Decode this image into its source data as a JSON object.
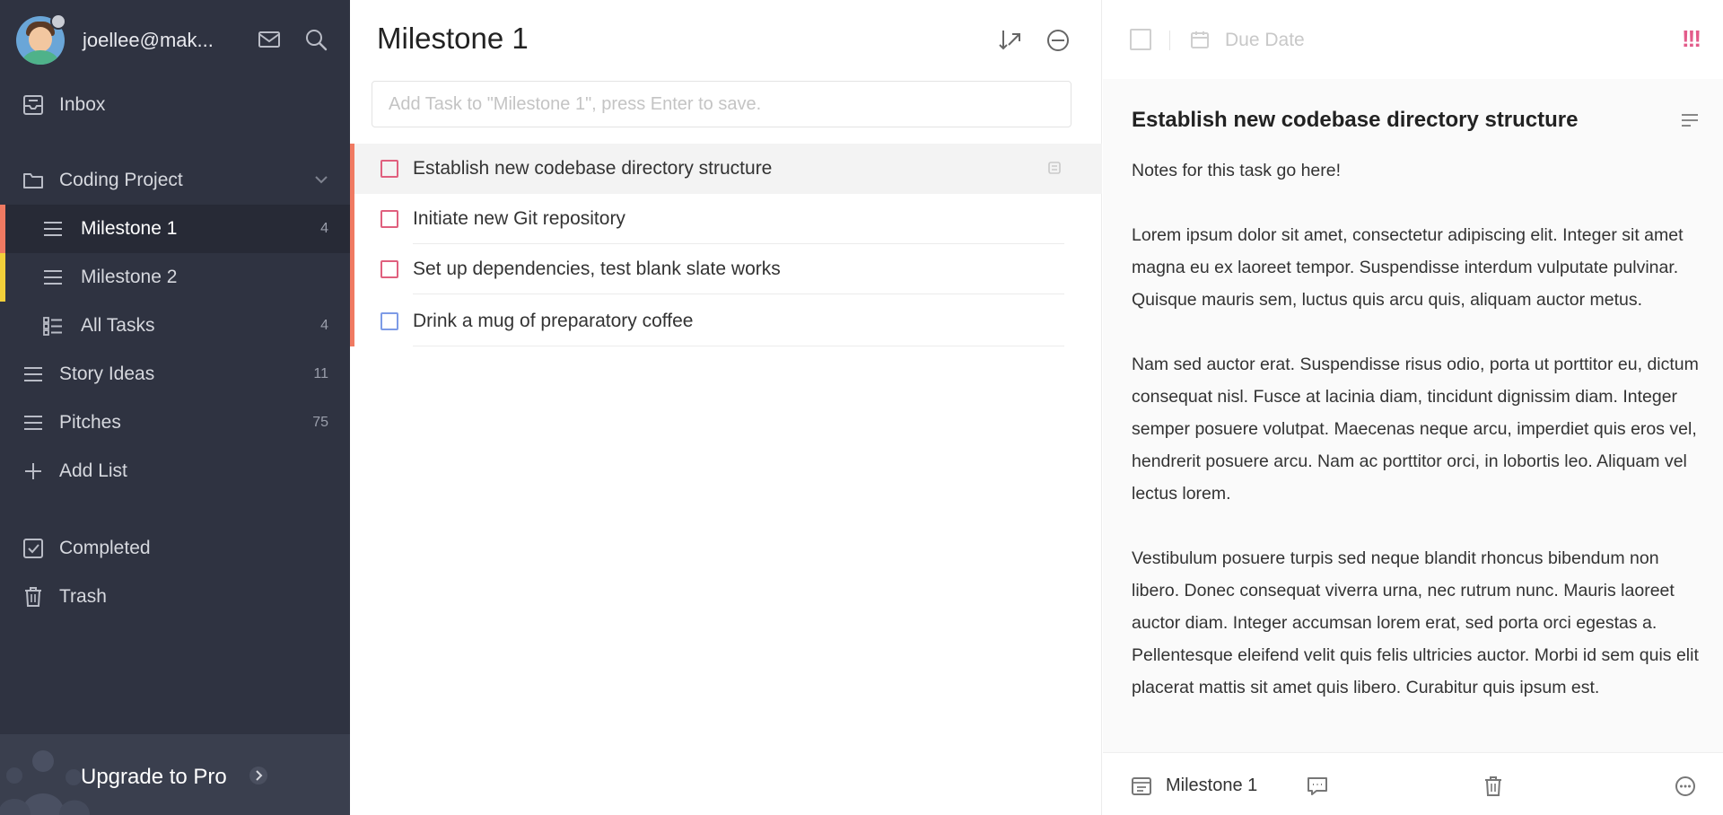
{
  "sidebar": {
    "username": "joellee@mak...",
    "items": [
      {
        "name": "inbox",
        "label": "Inbox",
        "count": "",
        "icon": "inbox-icon"
      },
      {
        "name": "coding-project",
        "label": "Coding Project",
        "count": "",
        "icon": "folder-icon"
      },
      {
        "name": "milestone-1",
        "label": "Milestone 1",
        "count": "4",
        "icon": "list-icon",
        "accent": "#f07a62"
      },
      {
        "name": "milestone-2",
        "label": "Milestone 2",
        "count": "",
        "icon": "list-icon",
        "accent": "#f2cf3a"
      },
      {
        "name": "all-tasks",
        "label": "All Tasks",
        "count": "4",
        "icon": "all-tasks-icon"
      },
      {
        "name": "story-ideas",
        "label": "Story Ideas",
        "count": "11",
        "icon": "list-icon"
      },
      {
        "name": "pitches",
        "label": "Pitches",
        "count": "75",
        "icon": "list-icon"
      },
      {
        "name": "add-list",
        "label": "Add List",
        "count": "",
        "icon": "plus-icon"
      },
      {
        "name": "completed",
        "label": "Completed",
        "count": "",
        "icon": "checkbox-icon"
      },
      {
        "name": "trash",
        "label": "Trash",
        "count": "",
        "icon": "trash-icon"
      }
    ],
    "upgrade_label": "Upgrade to Pro"
  },
  "list": {
    "title": "Milestone 1",
    "add_placeholder": "Add Task to \"Milestone 1\", press Enter to save.",
    "tasks": [
      {
        "title": "Establish new codebase directory structure",
        "priority_color": "#e0607e"
      },
      {
        "title": "Initiate new Git repository",
        "priority_color": "#e0607e"
      },
      {
        "title": "Set up dependencies, test blank slate works",
        "priority_color": "#e0607e"
      },
      {
        "title": "Drink a mug of preparatory coffee",
        "priority_color": "#7d9be6"
      }
    ]
  },
  "detail": {
    "due_label": "Due Date",
    "priority_mark": "!!!",
    "title": "Establish new codebase directory structure",
    "notes_first": "Notes for this task go here!",
    "paragraphs": [
      "Lorem ipsum dolor sit amet, consectetur adipiscing elit. Integer sit amet magna eu ex laoreet tempor. Suspendisse interdum vulputate pulvinar. Quisque mauris sem, luctus quis arcu quis, aliquam auctor metus.",
      "Nam sed auctor erat. Suspendisse risus odio, porta ut porttitor eu, dictum consequat nisl. Fusce at lacinia diam, tincidunt dignissim diam. Integer semper posuere volutpat. Maecenas neque arcu, imperdiet quis eros vel, hendrerit posuere arcu. Nam ac porttitor orci, in lobortis leo. Aliquam vel lectus lorem.",
      "Vestibulum posuere turpis sed neque blandit rhoncus bibendum non libero. Donec consequat viverra urna, nec rutrum nunc. Mauris laoreet auctor diam. Integer accumsan lorem erat, sed porta orci egestas a. Pellentesque eleifend velit quis felis ultricies auctor. Morbi id sem quis elit placerat mattis sit amet quis libero. Curabitur quis ipsum est."
    ],
    "footer_list": "Milestone 1"
  },
  "colors": {
    "sidebar_bg": "#2f3341",
    "active_bg": "#272a36",
    "accent_red": "#f07a62",
    "accent_yellow": "#f2cf3a",
    "priority_pink": "#e35b8a"
  }
}
